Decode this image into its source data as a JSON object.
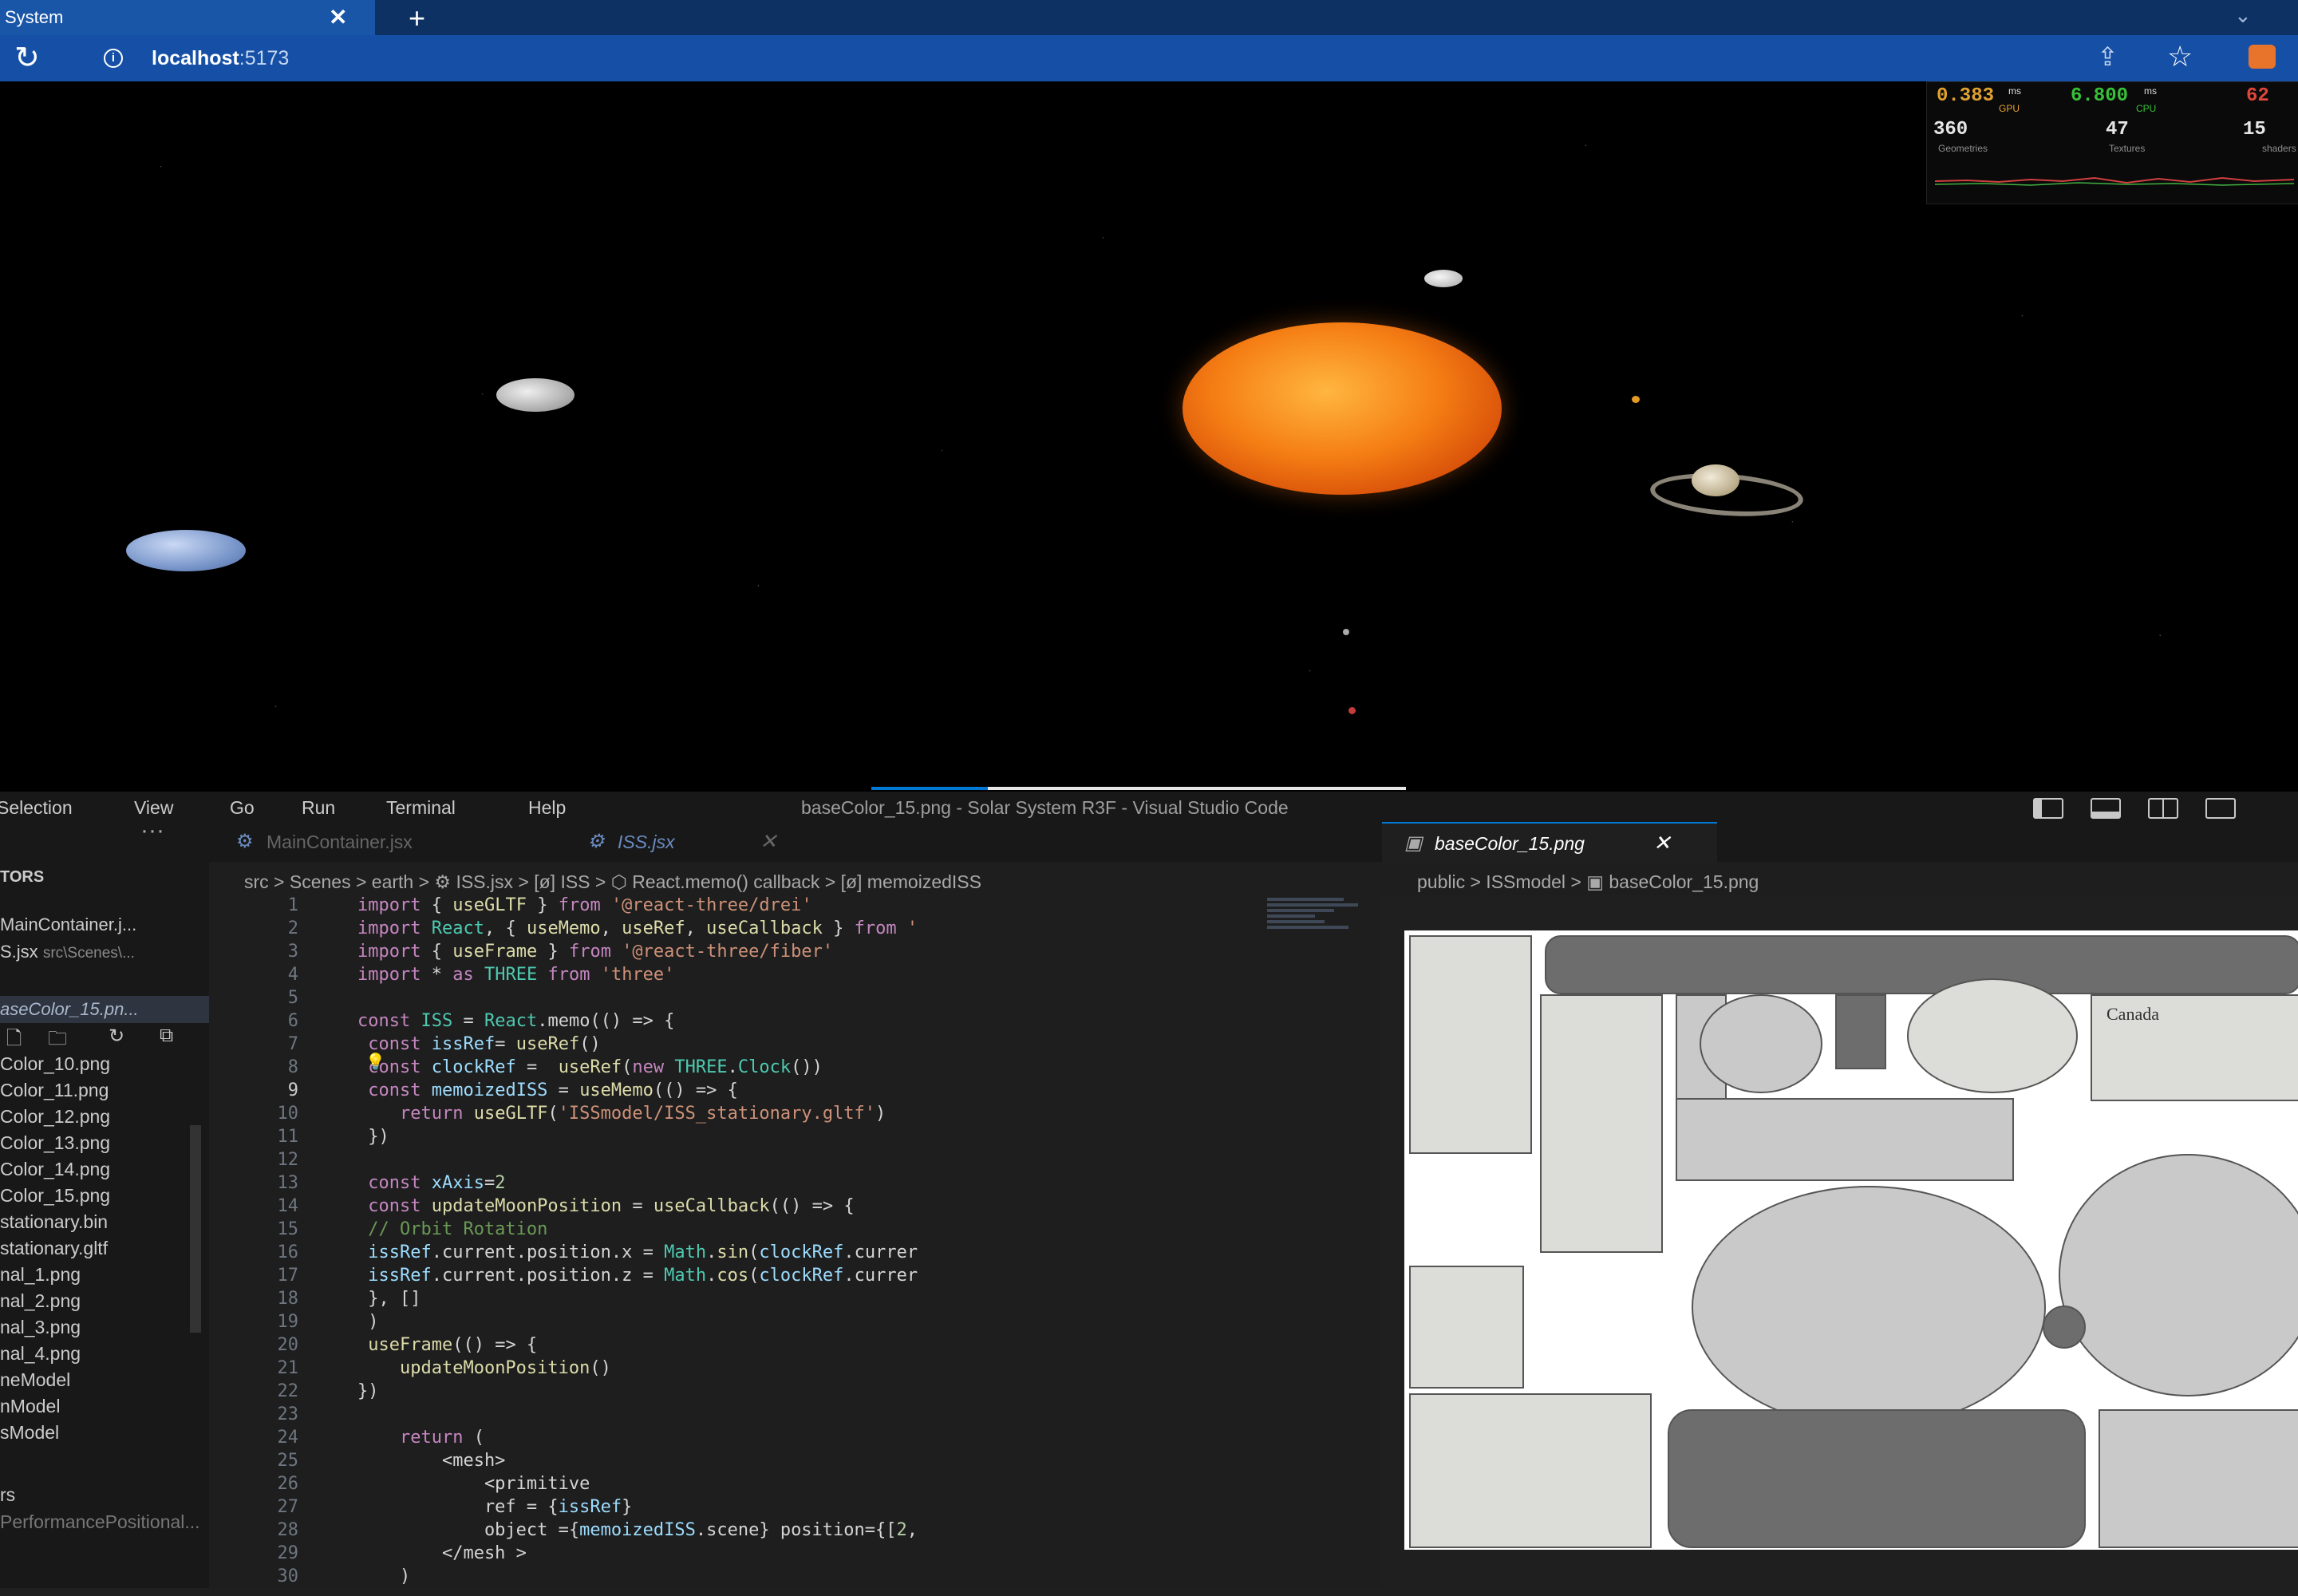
{
  "browser": {
    "tab_title": "System",
    "tab_close": "✕",
    "new_tab": "+",
    "reload_icon": "↻",
    "url_host": "localhost",
    "url_port": ":5173",
    "share_icon": "⇪",
    "star_icon": "☆"
  },
  "perf_monitor": {
    "gpu": {
      "value": "0.383",
      "unit": "ms",
      "label": "GPU",
      "color": "#e0a030"
    },
    "cpu": {
      "value": "6.800",
      "unit": "ms",
      "label": "CPU",
      "color": "#38c038"
    },
    "fps": {
      "value": "62",
      "color": "#e0463a"
    },
    "geometries": {
      "value": "360",
      "label": "Geometries"
    },
    "textures": {
      "value": "47",
      "label": "Textures"
    },
    "shaders": {
      "value": "15",
      "label": "shaders"
    }
  },
  "vscode": {
    "window_title": "baseColor_15.png - Solar System R3F - Visual Studio Code",
    "menu": [
      "Selection",
      "View",
      "Go",
      "Run",
      "Terminal",
      "Help"
    ],
    "explorer": {
      "more": "···",
      "section": "TORS",
      "open_editors": [
        {
          "name": "MainContainer.j...",
          "dir": ""
        },
        {
          "name": "S.jsx",
          "dir": "src\\Scenes\\..."
        }
      ],
      "selected": "aseColor_15.pn...",
      "files": [
        "Color_10.png",
        "Color_11.png",
        "Color_12.png",
        "Color_13.png",
        "Color_14.png",
        "Color_15.png",
        "stationary.bin",
        "stationary.gltf",
        "nal_1.png",
        "nal_2.png",
        "nal_3.png",
        "nal_4.png",
        "neModel",
        "nModel",
        "sModel",
        "rs",
        "PerformancePositional..."
      ]
    },
    "tabs": [
      {
        "label": "MainContainer.jsx",
        "active": false
      },
      {
        "label": "ISS.jsx",
        "active": false
      },
      {
        "label": "baseColor_15.png",
        "active": true
      }
    ],
    "tab_more": "···",
    "breadcrumb_left": "src > Scenes > earth > ⚙ ISS.jsx > [ø] ISS > ⬡ React.memo() callback > [ø] memoizedISS",
    "breadcrumb_right": "public > ISSmodel > ▣ baseColor_15.png",
    "line_numbers": [
      "1",
      "2",
      "3",
      "4",
      "5",
      "6",
      "7",
      "8",
      "9",
      "10",
      "11",
      "12",
      "13",
      "14",
      "15",
      "16",
      "17",
      "18",
      "19",
      "20",
      "21",
      "22",
      "23",
      "24",
      "25",
      "26",
      "27",
      "28",
      "29",
      "30"
    ],
    "current_line": "9",
    "code": [
      "import { useGLTF } from '@react-three/drei'",
      "import React, { useMemo, useRef, useCallback } from '",
      "import { useFrame } from '@react-three/fiber'",
      "import * as THREE from 'three'",
      "",
      "const ISS = React.memo(() => {",
      " const issRef= useRef()",
      " const clockRef =  useRef(new THREE.Clock())",
      " const memoizedISS = useMemo(() => {",
      "    return useGLTF('ISSmodel/ISS_stationary.gltf')",
      " })",
      "",
      " const xAxis=2",
      " const updateMoonPosition = useCallback(() => {",
      " // Orbit Rotation",
      " issRef.current.position.x = Math.sin(clockRef.currer",
      " issRef.current.position.z = Math.cos(clockRef.currer",
      " }, []",
      " )",
      " useFrame(() => {",
      "    updateMoonPosition()",
      "})",
      "",
      "    return (",
      "        <mesh>",
      "            <primitive",
      "            ref = {issRef}",
      "            object ={memoizedISS.scene} position={[2,",
      "        </mesh >",
      "    )"
    ]
  },
  "texture_label": "Canada",
  "colors": {
    "browser_tab": "#1a56a8",
    "browser_bar": "#1650a6",
    "editor_bg": "#1e1e1e",
    "sun": "#f57e14"
  }
}
